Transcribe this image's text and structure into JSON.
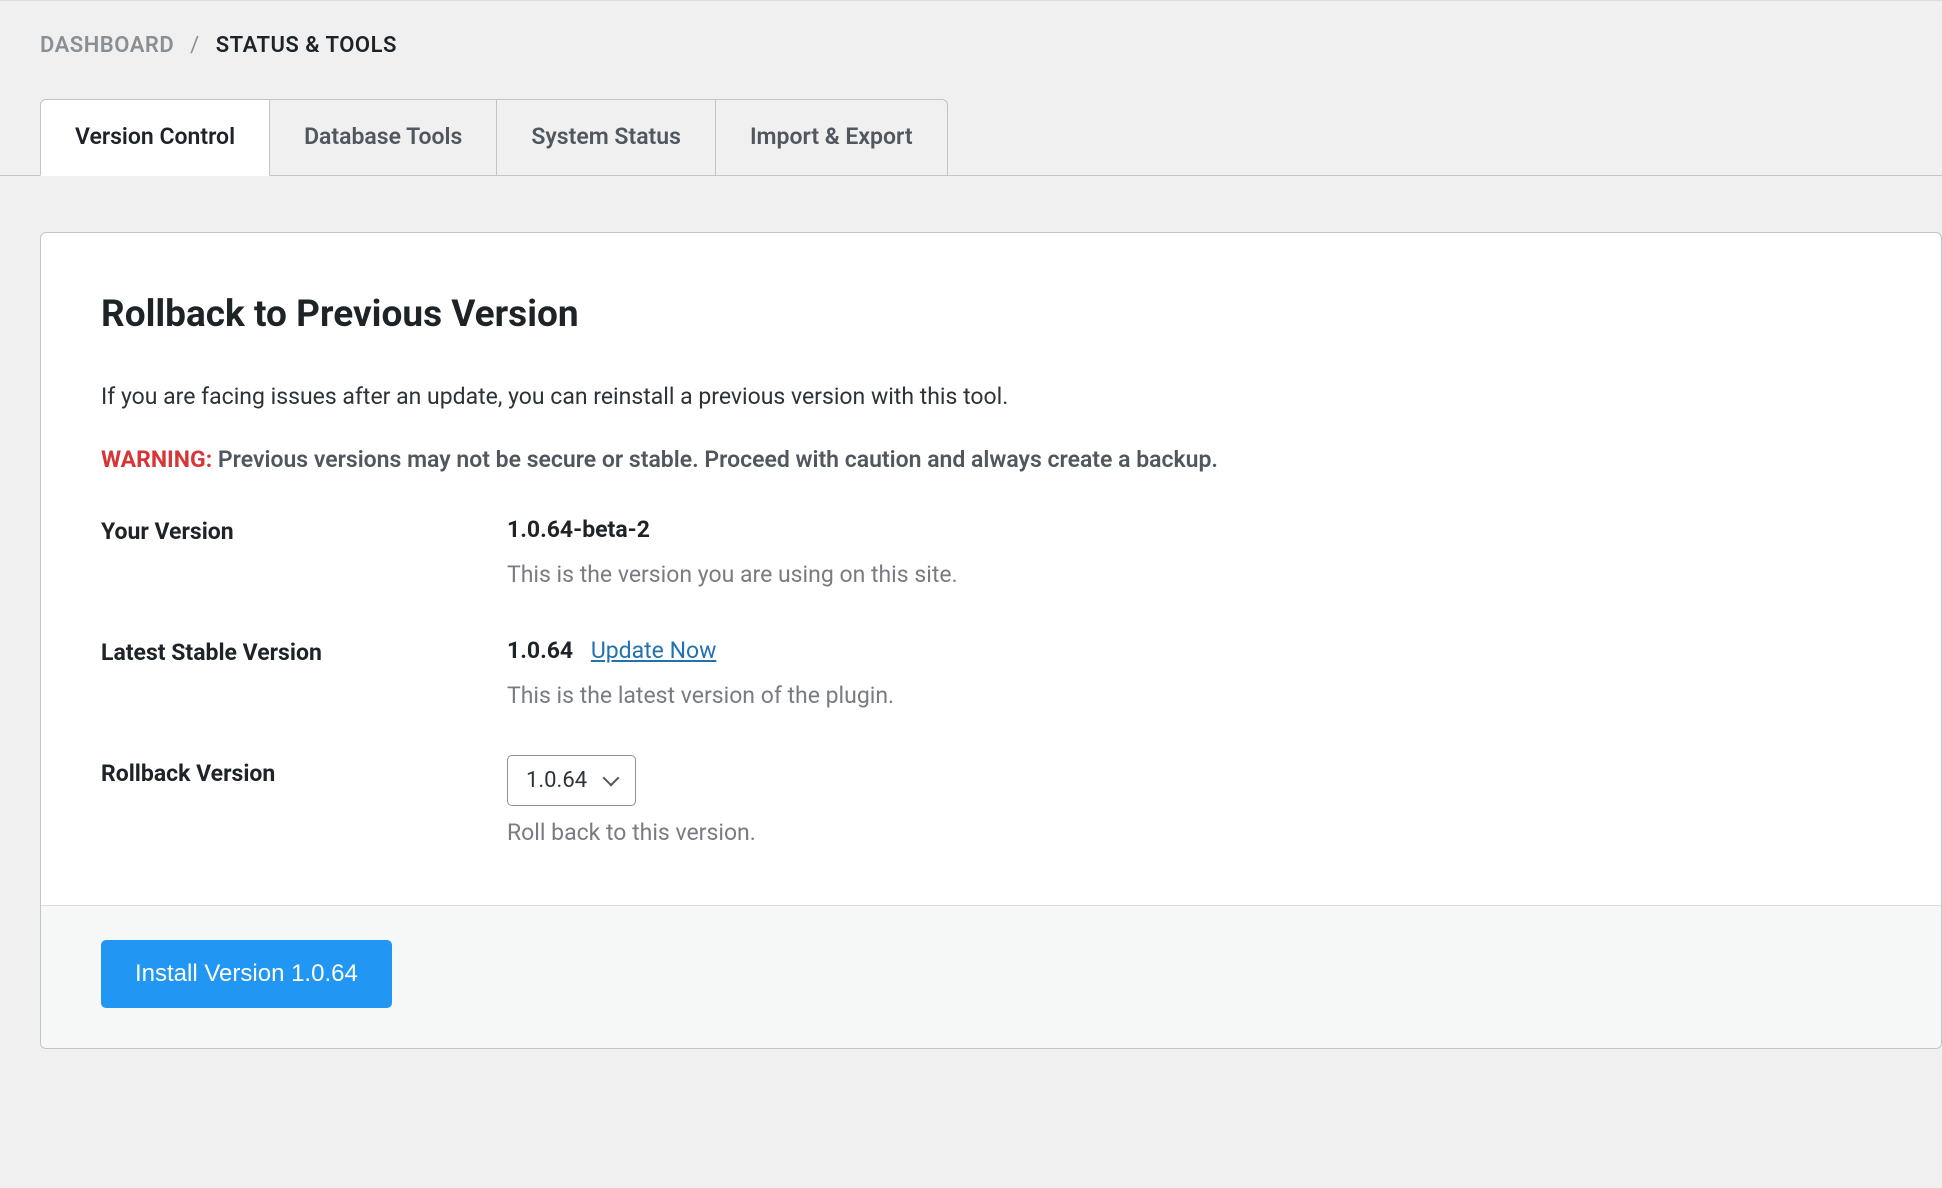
{
  "breadcrumb": {
    "root": "DASHBOARD",
    "separator": "/",
    "current": "STATUS & TOOLS"
  },
  "tabs": [
    {
      "label": "Version Control",
      "active": true
    },
    {
      "label": "Database Tools",
      "active": false
    },
    {
      "label": "System Status",
      "active": false
    },
    {
      "label": "Import & Export",
      "active": false
    }
  ],
  "panel": {
    "title": "Rollback to Previous Version",
    "description": "If you are facing issues after an update, you can reinstall a previous version with this tool.",
    "warning_label": "WARNING:",
    "warning_text": "Previous versions may not be secure or stable. Proceed with caution and always create a backup.",
    "your_version": {
      "label": "Your Version",
      "value": "1.0.64-beta-2",
      "help": "This is the version you are using on this site."
    },
    "latest_stable": {
      "label": "Latest Stable Version",
      "value": "1.0.64",
      "update_link": "Update Now",
      "help": "This is the latest version of the plugin."
    },
    "rollback": {
      "label": "Rollback Version",
      "selected": "1.0.64",
      "help": "Roll back to this version."
    },
    "install_button": "Install Version 1.0.64"
  }
}
